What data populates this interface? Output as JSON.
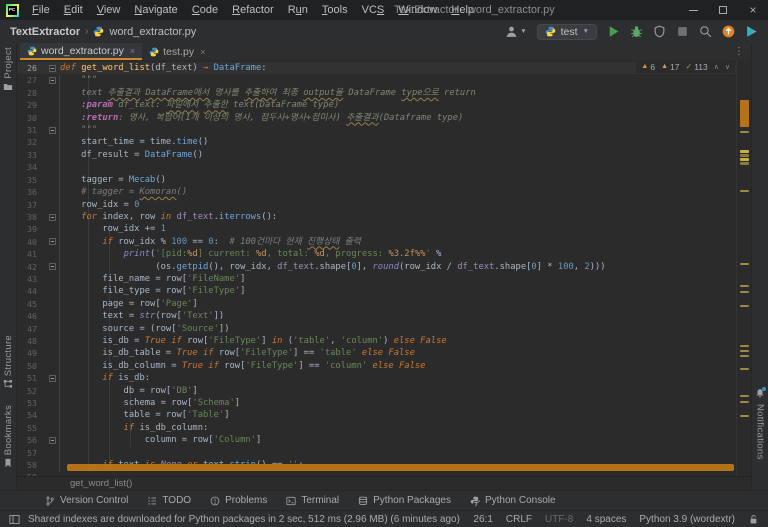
{
  "window": {
    "title": "TextExtractor - word_extractor.py",
    "logo": "PC"
  },
  "menu": {
    "items": [
      {
        "label": "File",
        "m": 0
      },
      {
        "label": "Edit",
        "m": 0
      },
      {
        "label": "View",
        "m": 0
      },
      {
        "label": "Navigate",
        "m": 0
      },
      {
        "label": "Code",
        "m": 0
      },
      {
        "label": "Refactor",
        "m": 0
      },
      {
        "label": "Run",
        "m": 1
      },
      {
        "label": "Tools",
        "m": 0
      },
      {
        "label": "VCS",
        "m": 2
      },
      {
        "label": "Window",
        "m": 0
      },
      {
        "label": "Help",
        "m": 0
      }
    ]
  },
  "window_controls": {
    "minimize": "minimize-icon",
    "maximize": "maximize-icon",
    "close_glyph": "×"
  },
  "navbar": {
    "project": "TextExtractor",
    "separator": "›",
    "file": "word_extractor.py",
    "run_config": "test",
    "actions": [
      {
        "name": "user-dropdown",
        "icon": "person",
        "caret": true
      },
      {
        "name": "run-config-selector",
        "icon": "python",
        "label": "test",
        "pill": true,
        "caret": true
      },
      {
        "name": "run-button",
        "icon": "play"
      },
      {
        "name": "debug-button",
        "icon": "bug"
      },
      {
        "name": "coverage-button",
        "icon": "coverage"
      },
      {
        "name": "stop-button",
        "icon": "stop"
      },
      {
        "name": "search-everywhere-button",
        "icon": "search"
      },
      {
        "name": "update-button",
        "icon": "update"
      },
      {
        "name": "services-button",
        "icon": "colorplay"
      }
    ]
  },
  "tabs": {
    "close_glyph": "×",
    "kebab_glyph": "⋮",
    "items": [
      {
        "label": "word_extractor.py",
        "active": true
      },
      {
        "label": "test.py",
        "active": false
      }
    ]
  },
  "left_stripe": {
    "top": [
      {
        "label": "Project",
        "icon": "folder"
      }
    ],
    "bottom": [
      {
        "label": "Structure",
        "icon": "structure"
      },
      {
        "label": "Bookmarks",
        "icon": "bookmark"
      }
    ]
  },
  "right_stripe": {
    "bottom": [
      {
        "label": "Notifications",
        "icon": "bell",
        "badge": true
      }
    ]
  },
  "editor": {
    "inspections": {
      "errors": "6",
      "warnings": "17",
      "typos": "113",
      "up_glyph": "∧",
      "down_glyph": "∨"
    },
    "breadcrumb": "get_word_list()",
    "lines": [
      {
        "n": 26,
        "fold": "m",
        "cur": true,
        "t": [
          [
            "kw",
            "def "
          ],
          [
            "fn",
            "get_word_list"
          ],
          [
            "p",
            "(df_text) "
          ],
          [
            "ar",
            "→ "
          ],
          [
            "call",
            "DataFrame"
          ],
          [
            "p",
            ":"
          ]
        ]
      },
      {
        "n": 27,
        "fold": "m",
        "t": [
          [
            "doc",
            "    \"\"\""
          ]
        ]
      },
      {
        "n": 28,
        "t": [
          [
            "doc",
            "    text "
          ],
          [
            "doc ty",
            "추출결과"
          ],
          [
            "doc",
            " "
          ],
          [
            "doc ty",
            "DataFrame에서"
          ],
          [
            "doc",
            " 명사를 "
          ],
          [
            "doc ty",
            "추출하여"
          ],
          [
            "doc",
            " 최종 "
          ],
          [
            "doc ty",
            "output을"
          ],
          [
            "doc",
            " DataFrame "
          ],
          [
            "doc ty",
            "type으로"
          ],
          [
            "doc",
            " return"
          ]
        ]
      },
      {
        "n": 29,
        "t": [
          [
            "doc",
            "    "
          ],
          [
            "dt",
            ":param"
          ],
          [
            "doc",
            " df_text: "
          ],
          [
            "doc ty",
            "파일에서"
          ],
          [
            "doc",
            " "
          ],
          [
            "doc ty",
            "추출한"
          ],
          [
            "doc",
            " text(DataFrame type)"
          ]
        ]
      },
      {
        "n": 30,
        "t": [
          [
            "doc",
            "    "
          ],
          [
            "dt",
            ":return"
          ],
          [
            "doc",
            ": 명사, 복합어(1개 이상의 명사, 접두사+명사+접미사) "
          ],
          [
            "doc ty",
            "추출결과"
          ],
          [
            "doc",
            "(Dataframe type)"
          ]
        ]
      },
      {
        "n": 31,
        "fold": "e",
        "t": [
          [
            "doc",
            "    \"\"\""
          ]
        ]
      },
      {
        "n": 32,
        "t": [
          [
            "p",
            "    start_time = time."
          ],
          [
            "call",
            "time"
          ],
          [
            "p",
            "()"
          ]
        ]
      },
      {
        "n": 33,
        "t": [
          [
            "p",
            "    df_result = "
          ],
          [
            "call",
            "DataFrame"
          ],
          [
            "p",
            "()"
          ]
        ]
      },
      {
        "n": 34,
        "t": []
      },
      {
        "n": 35,
        "t": [
          [
            "p",
            "    tagger = "
          ],
          [
            "call",
            "Mecab"
          ],
          [
            "p",
            "()"
          ]
        ]
      },
      {
        "n": 36,
        "t": [
          [
            "c",
            "    # tagger = "
          ],
          [
            "c ty",
            "Komoran"
          ],
          [
            "c",
            "()"
          ]
        ]
      },
      {
        "n": 37,
        "t": [
          [
            "p",
            "    row_idx = "
          ],
          [
            "n",
            "0"
          ]
        ]
      },
      {
        "n": 38,
        "fold": "m",
        "t": [
          [
            "kw",
            "    for "
          ],
          [
            "p",
            "index, row "
          ],
          [
            "kw",
            "in "
          ],
          [
            "param",
            "df_text"
          ],
          [
            "p",
            "."
          ],
          [
            "call",
            "iterrows"
          ],
          [
            "p",
            "():"
          ]
        ]
      },
      {
        "n": 39,
        "t": [
          [
            "p",
            "        row_idx += "
          ],
          [
            "n",
            "1"
          ]
        ]
      },
      {
        "n": 40,
        "fold": "m",
        "t": [
          [
            "kw",
            "        if "
          ],
          [
            "p",
            "row_idx % "
          ],
          [
            "n",
            "100"
          ],
          [
            "p",
            " == "
          ],
          [
            "n",
            "0"
          ],
          [
            "p",
            ":  "
          ],
          [
            "c",
            "# 100건마다 현재 "
          ],
          [
            "c ty",
            "진행상태"
          ],
          [
            "c",
            " 출력"
          ]
        ]
      },
      {
        "n": 41,
        "t": [
          [
            "p",
            "            "
          ],
          [
            "bi",
            "print"
          ],
          [
            "p",
            "("
          ],
          [
            "s",
            "'[pid:"
          ],
          [
            "sf",
            "%d"
          ],
          [
            "s",
            "] current: "
          ],
          [
            "sf",
            "%d"
          ],
          [
            "s",
            ", total: "
          ],
          [
            "sf",
            "%d"
          ],
          [
            "s",
            ", progress: "
          ],
          [
            "sf",
            "%3.2f%%"
          ],
          [
            "s",
            "'"
          ],
          [
            "p",
            " %"
          ]
        ]
      },
      {
        "n": 42,
        "fold": "e",
        "t": [
          [
            "p",
            "                  (os."
          ],
          [
            "call",
            "getpid"
          ],
          [
            "p",
            "(), row_idx, "
          ],
          [
            "param",
            "df_text"
          ],
          [
            "p",
            ".shape["
          ],
          [
            "n",
            "0"
          ],
          [
            "p",
            "], "
          ],
          [
            "bi",
            "round"
          ],
          [
            "p",
            "(row_idx / "
          ],
          [
            "param",
            "df_text"
          ],
          [
            "p",
            ".shape["
          ],
          [
            "n",
            "0"
          ],
          [
            "p",
            "] * "
          ],
          [
            "n",
            "100"
          ],
          [
            "p",
            ", "
          ],
          [
            "n",
            "2"
          ],
          [
            "p",
            ")))"
          ]
        ]
      },
      {
        "n": 43,
        "t": [
          [
            "p",
            "        file_name = row["
          ],
          [
            "s",
            "'FileName'"
          ],
          [
            "p",
            "]"
          ]
        ]
      },
      {
        "n": 44,
        "t": [
          [
            "p",
            "        file_type = row["
          ],
          [
            "s",
            "'FileType'"
          ],
          [
            "p",
            "]"
          ]
        ]
      },
      {
        "n": 45,
        "t": [
          [
            "p",
            "        page = row["
          ],
          [
            "s",
            "'Page'"
          ],
          [
            "p",
            "]"
          ]
        ]
      },
      {
        "n": 46,
        "t": [
          [
            "p",
            "        text = "
          ],
          [
            "bi",
            "str"
          ],
          [
            "p",
            "(row["
          ],
          [
            "s",
            "'Text'"
          ],
          [
            "p",
            "])"
          ]
        ]
      },
      {
        "n": 47,
        "t": [
          [
            "p",
            "        source = (row["
          ],
          [
            "s",
            "'Source'"
          ],
          [
            "p",
            "])"
          ]
        ]
      },
      {
        "n": 48,
        "t": [
          [
            "p",
            "        is_db = "
          ],
          [
            "kw",
            "True if "
          ],
          [
            "p",
            "row["
          ],
          [
            "s",
            "'FileType'"
          ],
          [
            "p",
            "] "
          ],
          [
            "kw",
            "in "
          ],
          [
            "p",
            "("
          ],
          [
            "s",
            "'table'"
          ],
          [
            "p",
            ", "
          ],
          [
            "s",
            "'column'"
          ],
          [
            "p",
            ") "
          ],
          [
            "kw",
            "else False"
          ]
        ]
      },
      {
        "n": 49,
        "t": [
          [
            "p",
            "        is_db_table = "
          ],
          [
            "kw",
            "True if "
          ],
          [
            "p",
            "row["
          ],
          [
            "s",
            "'FileType'"
          ],
          [
            "p",
            "] == "
          ],
          [
            "s",
            "'table'"
          ],
          [
            "p",
            " "
          ],
          [
            "kw",
            "else False"
          ]
        ]
      },
      {
        "n": 50,
        "t": [
          [
            "p",
            "        is_db_column = "
          ],
          [
            "kw",
            "True if "
          ],
          [
            "p",
            "row["
          ],
          [
            "s",
            "'FileType'"
          ],
          [
            "p",
            "] == "
          ],
          [
            "s",
            "'column'"
          ],
          [
            "p",
            " "
          ],
          [
            "kw",
            "else False"
          ]
        ]
      },
      {
        "n": 51,
        "fold": "m",
        "t": [
          [
            "kw",
            "        if "
          ],
          [
            "p",
            "is_db:"
          ]
        ]
      },
      {
        "n": 52,
        "t": [
          [
            "p",
            "            db = row["
          ],
          [
            "s",
            "'DB'"
          ],
          [
            "p",
            "]"
          ]
        ]
      },
      {
        "n": 53,
        "t": [
          [
            "p",
            "            schema = row["
          ],
          [
            "s",
            "'Schema'"
          ],
          [
            "p",
            "]"
          ]
        ]
      },
      {
        "n": 54,
        "t": [
          [
            "p",
            "            table = row["
          ],
          [
            "s",
            "'Table'"
          ],
          [
            "p",
            "]"
          ]
        ]
      },
      {
        "n": 55,
        "t": [
          [
            "kw",
            "            if "
          ],
          [
            "p",
            "is_db_column:"
          ]
        ]
      },
      {
        "n": 56,
        "fold": "m",
        "t": [
          [
            "p",
            "                column = row["
          ],
          [
            "s",
            "'Column'"
          ],
          [
            "p",
            "]"
          ]
        ]
      },
      {
        "n": 57,
        "t": []
      },
      {
        "n": 58,
        "t": [
          [
            "kw",
            "        if "
          ],
          [
            "p",
            "text "
          ],
          [
            "kw",
            "is "
          ],
          [
            "kwn",
            "None "
          ],
          [
            "kw",
            "or "
          ],
          [
            "p",
            "text."
          ],
          [
            "call",
            "strip"
          ],
          [
            "p",
            "() == "
          ],
          [
            "s",
            "''"
          ],
          [
            "p",
            ":"
          ]
        ]
      },
      {
        "n": 59,
        "t": []
      }
    ],
    "stripe_marks": [
      {
        "t": 40,
        "h": 27,
        "c": "#B4731B"
      },
      {
        "t": 71,
        "h": 2,
        "c": "#9C8B42"
      },
      {
        "t": 90,
        "h": 3,
        "c": "#C9B146"
      },
      {
        "t": 94,
        "h": 3,
        "c": "#8A7A3A"
      },
      {
        "t": 98,
        "h": 3,
        "c": "#C9B146"
      },
      {
        "t": 102,
        "h": 3,
        "c": "#8A7A3A"
      },
      {
        "t": 130,
        "h": 2,
        "c": "#9C8B42"
      },
      {
        "t": 203,
        "h": 2,
        "c": "#9C8B42"
      },
      {
        "t": 225,
        "h": 2,
        "c": "#9C8B42"
      },
      {
        "t": 231,
        "h": 2,
        "c": "#9C8B42"
      },
      {
        "t": 245,
        "h": 2,
        "c": "#9C8B42"
      },
      {
        "t": 285,
        "h": 2,
        "c": "#9C8B42"
      },
      {
        "t": 290,
        "h": 2,
        "c": "#9C8B42"
      },
      {
        "t": 295,
        "h": 2,
        "c": "#9C8B42"
      },
      {
        "t": 308,
        "h": 2,
        "c": "#9C8B42"
      },
      {
        "t": 335,
        "h": 2,
        "c": "#9C8B42"
      },
      {
        "t": 341,
        "h": 2,
        "c": "#9C8B42"
      },
      {
        "t": 355,
        "h": 2,
        "c": "#9C8B42"
      }
    ]
  },
  "bottom_bar": {
    "items": [
      {
        "label": "Version Control",
        "icon": "branch"
      },
      {
        "label": "TODO",
        "icon": "todo"
      },
      {
        "label": "Problems",
        "icon": "problems"
      },
      {
        "label": "Terminal",
        "icon": "terminal"
      },
      {
        "label": "Python Packages",
        "icon": "packages"
      },
      {
        "label": "Python Console",
        "icon": "pyconsole"
      }
    ]
  },
  "statusbar": {
    "message": "Shared indexes are downloaded for Python packages in 2 sec, 512 ms (2.96 MB) (6 minutes ago)",
    "segments": [
      "26:1",
      "CRLF",
      "UTF-8",
      "4 spaces",
      "Python 3.9 (wordextr)"
    ]
  },
  "colors": {
    "accent_tab_underline": "#D0882F",
    "horizontal_scrollbar": "#B4731B",
    "run_green": "#499C54",
    "debug_green": "#59A869",
    "update_orange": "#E08027",
    "notification_blue": "#3592C4",
    "editor_background": "#2B2B2B"
  }
}
